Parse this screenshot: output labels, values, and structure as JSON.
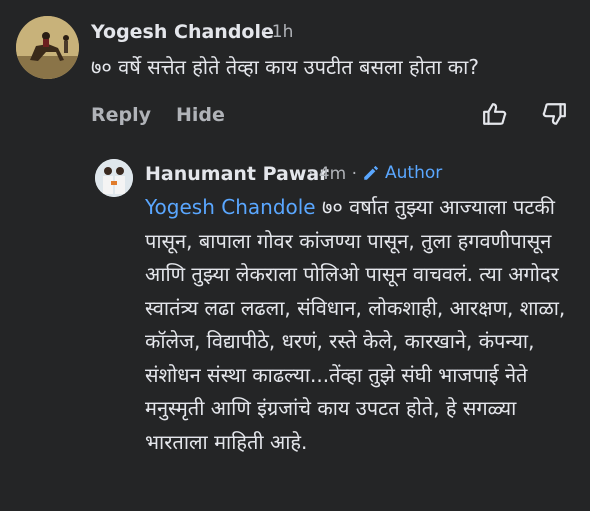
{
  "comment1": {
    "author": "Yogesh Chandole",
    "time": "· 1h",
    "text": "७० वर्षे सत्तेत होते तेव्हा काय उपटीत बसला होता का?",
    "reply_label": "Reply",
    "hide_label": "Hide",
    "icons": [
      "like-icon",
      "dislike-icon"
    ]
  },
  "comment2": {
    "author": "Hanumant Pawar",
    "time": "· 4m ·",
    "badge": "Author",
    "mention": "Yogesh Chandole",
    "text": " ७० वर्षात तुझ्या आज्याला पटकी पासून, बापाला गोवर कांजण्या पासून, तुला हगवणीपासून आणि तुझ्या लेकराला पोलिओ पासून वाचवलं. त्या अगोदर स्वातंत्र्य लढा लढला, संविधान, लोकशाही, आरक्षण, शाळा, कॉलेज, विद्यापीठे, धरणं, रस्ते केले, कारखाने, कंपन्या, संशोधन संस्था काढल्या...तेंव्हा तुझे संघी भाजपाई नेते मनुस्मृती आणि इंग्रजांचे काय उपटत होते, हे सगळ्या भारताला माहिती आहे."
  },
  "colors": {
    "background": "#242526",
    "text": "#e4e6eb",
    "muted": "#b0b3b8",
    "accent": "#5aa7ff"
  }
}
